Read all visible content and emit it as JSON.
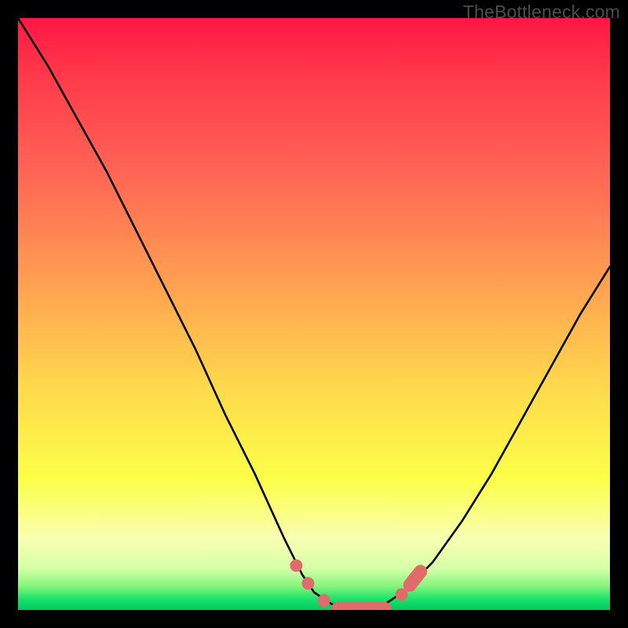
{
  "watermark": "TheBottleneck.com",
  "colors": {
    "frame": "#000000",
    "curve_stroke": "#000000",
    "marker_fill": "#e16a6a",
    "marker_stroke": "#c95a5a",
    "gradient_top": "#ff1744",
    "gradient_bottom": "#08c95f"
  },
  "chart_data": {
    "type": "line",
    "title": "",
    "xlabel": "",
    "ylabel": "",
    "xlim": [
      0,
      100
    ],
    "ylim": [
      0,
      100
    ],
    "grid": false,
    "legend": false,
    "series": [
      {
        "name": "bottleneck-curve",
        "x": [
          0,
          5,
          10,
          15,
          20,
          25,
          30,
          35,
          40,
          45,
          48,
          50,
          53,
          56,
          58,
          60,
          62,
          65,
          70,
          75,
          80,
          85,
          90,
          95,
          100
        ],
        "y": [
          100,
          92,
          83,
          74,
          64,
          54,
          44,
          33,
          23,
          12,
          6,
          3,
          1,
          0,
          0,
          0,
          1,
          3,
          8,
          15,
          23,
          32,
          41,
          50,
          58
        ]
      }
    ],
    "markers": [
      {
        "kind": "dot",
        "x": 47.0,
        "y": 7.5
      },
      {
        "kind": "dot",
        "x": 49.0,
        "y": 4.5
      },
      {
        "kind": "dot",
        "x": 51.7,
        "y": 1.6
      },
      {
        "kind": "capsule",
        "x1": 54.0,
        "x2": 62.0,
        "y": 0.2
      },
      {
        "kind": "dot",
        "x": 64.8,
        "y": 2.6
      },
      {
        "kind": "capsule_diag",
        "x1": 66.2,
        "y1": 4.2,
        "x2": 68.0,
        "y2": 6.5
      }
    ]
  }
}
